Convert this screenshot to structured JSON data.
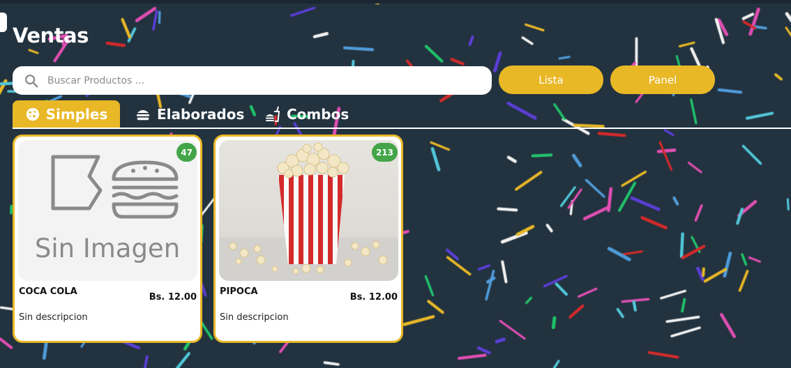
{
  "page": {
    "title": "Ventas"
  },
  "search": {
    "placeholder": "Buscar Productos ..."
  },
  "buttons": {
    "lista": "Lista",
    "panel": "Panel"
  },
  "tabs": [
    {
      "label": "Simples",
      "icon": "cookie-icon",
      "active": true
    },
    {
      "label": "Elaborados",
      "icon": "burger-icon",
      "active": false
    },
    {
      "label": "Combos",
      "icon": "fastfood-icon",
      "active": false
    }
  ],
  "products": [
    {
      "name": "COCA COLA",
      "price": "Bs. 12.00",
      "stock": "47",
      "description": "Sin descripcion",
      "image_text": "Sin Imagen"
    },
    {
      "name": "PIPOCA",
      "price": "Bs. 12.00",
      "stock": "213",
      "description": "Sin descripcion"
    }
  ],
  "colors": {
    "background": "#22323f",
    "accent": "#e9b827",
    "badge": "#43a547",
    "popcorn_stripe": "#d42a2a"
  }
}
